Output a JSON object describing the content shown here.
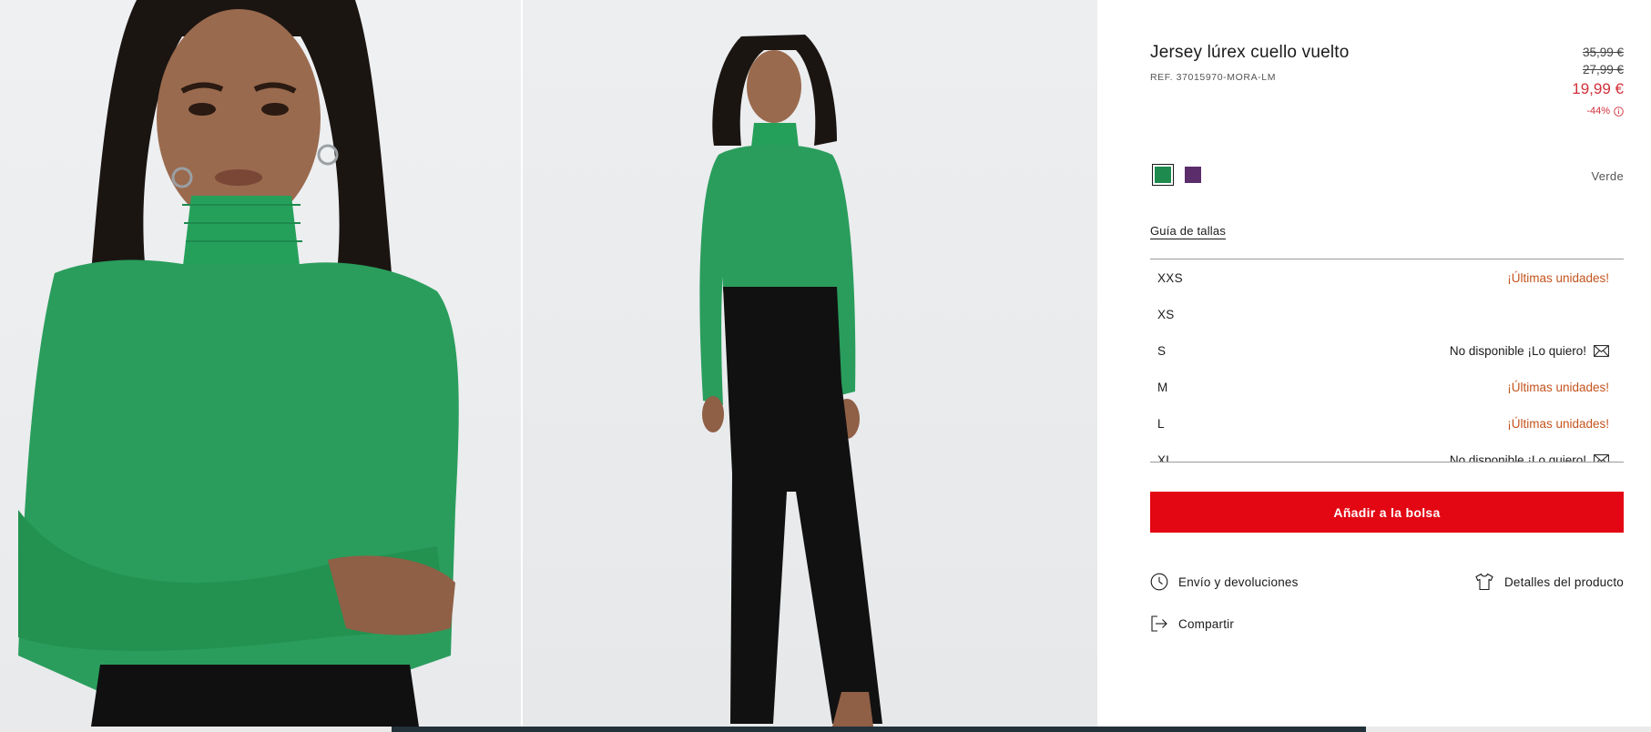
{
  "gallery": {
    "images": [
      {
        "alt": "close-up photo of model wearing green turtleneck sweater"
      },
      {
        "alt": "full-length photo of model wearing green turtleneck and black trousers"
      }
    ]
  },
  "product": {
    "title": "Jersey lúrex cuello vuelto",
    "reference": "REF. 37015970-MORA-LM",
    "prices": {
      "original": "35,99 €",
      "previous": "27,99 €",
      "current": "19,99 €",
      "discount": "-44%"
    },
    "colors": {
      "selected_name": "Verde",
      "swatches": [
        {
          "name": "Verde",
          "hex": "#1e8a4e",
          "selected": true
        },
        {
          "name": "Morado",
          "hex": "#5b2d6b",
          "selected": false
        }
      ]
    },
    "size_guide_label": "Guía de tallas",
    "sizes": [
      {
        "label": "XXS",
        "status": "¡Últimas unidades!",
        "type": "last"
      },
      {
        "label": "XS",
        "status": "",
        "type": "available"
      },
      {
        "label": "S",
        "status": "No disponible ¡Lo quiero!",
        "type": "unavailable"
      },
      {
        "label": "M",
        "status": "¡Últimas unidades!",
        "type": "last"
      },
      {
        "label": "L",
        "status": "¡Últimas unidades!",
        "type": "last"
      },
      {
        "label": "XL",
        "status": "No disponible ¡Lo quiero!",
        "type": "unavailable"
      }
    ],
    "add_to_bag_label": "Añadir a la bolsa",
    "links": {
      "shipping": "Envío y devoluciones",
      "details": "Detalles del producto",
      "share": "Compartir"
    }
  },
  "colors": {
    "accent_red": "#e30613",
    "sale_red": "#d1303b",
    "last_units_orange": "#c4541e",
    "sweater_green": "#2a9d5c"
  }
}
